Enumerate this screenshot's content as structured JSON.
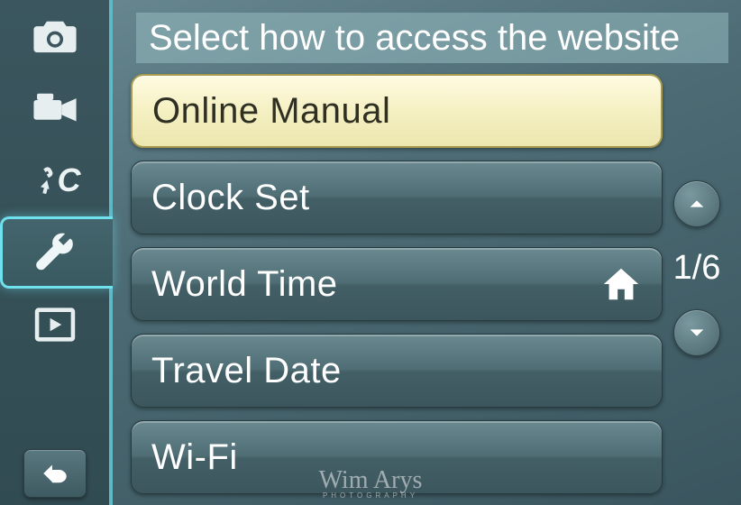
{
  "title": "Select how to access the website",
  "page_indicator": "1/6",
  "watermark": {
    "name": "Wim Arys",
    "sub": "PHOTOGRAPHY"
  },
  "tabs": [
    {
      "id": "camera",
      "icon": "camera-icon"
    },
    {
      "id": "video",
      "icon": "video-icon"
    },
    {
      "id": "custom",
      "icon": "custom-fc-icon",
      "label": "C"
    },
    {
      "id": "setup",
      "icon": "wrench-icon",
      "active": true
    },
    {
      "id": "playback",
      "icon": "playback-icon"
    }
  ],
  "menu": [
    {
      "id": "online-manual",
      "label": "Online Manual",
      "selected": true
    },
    {
      "id": "clock-set",
      "label": "Clock Set"
    },
    {
      "id": "world-time",
      "label": "World Time",
      "right_icon": "home-icon"
    },
    {
      "id": "travel-date",
      "label": "Travel Date"
    },
    {
      "id": "wifi",
      "label": "Wi-Fi"
    }
  ]
}
